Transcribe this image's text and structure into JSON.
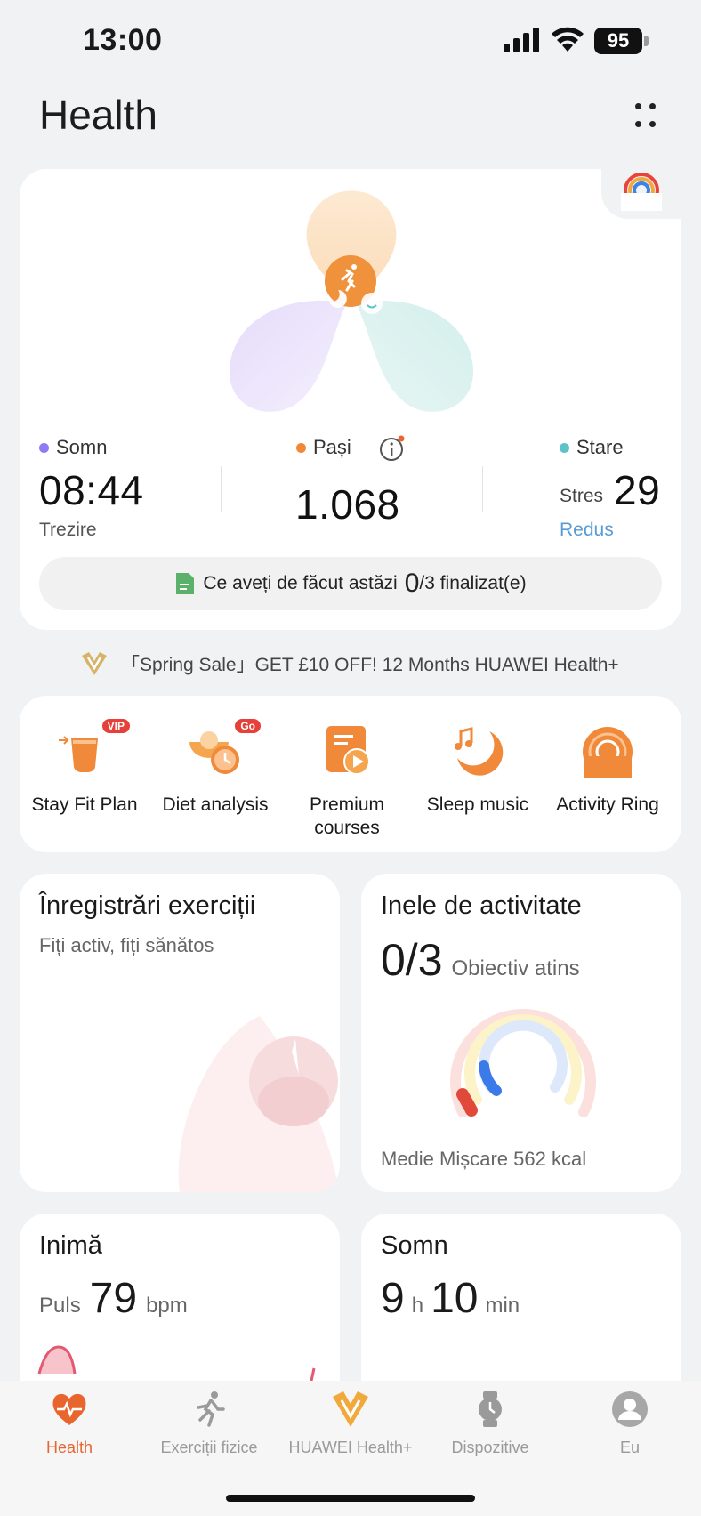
{
  "status_bar": {
    "time": "13:00",
    "battery": "95"
  },
  "header": {
    "title": "Health"
  },
  "summary": {
    "sleep": {
      "label": "Somn",
      "value": "08:44",
      "sub": "Trezire",
      "color": "#8b7cf6"
    },
    "steps": {
      "label": "Pași",
      "value": "1.068",
      "color": "#f0883a"
    },
    "mood": {
      "label": "Stare",
      "prefix": "Stres",
      "value": "29",
      "sub": "Redus",
      "color": "#5ec3c9"
    },
    "todo": {
      "text": "Ce aveți de făcut astăzi",
      "done": "0",
      "total": "/3 finalizat(e)"
    }
  },
  "promo": {
    "text": "「Spring Sale」GET £10 OFF!  12 Months HUAWEI Health+"
  },
  "quick_actions": [
    {
      "label": "Stay Fit Plan",
      "tag": "VIP",
      "icon": "fit-plan-icon"
    },
    {
      "label": "Diet analysis",
      "tag": "Go",
      "icon": "diet-icon"
    },
    {
      "label": "Premium courses",
      "tag": "",
      "icon": "courses-icon"
    },
    {
      "label": "Sleep music",
      "tag": "",
      "icon": "sleep-music-icon"
    },
    {
      "label": "Activity Ring",
      "tag": "",
      "icon": "activity-ring-icon"
    }
  ],
  "tiles": {
    "exercise": {
      "title": "Înregistrări exerciții",
      "sub": "Fiți activ, fiți sănătos"
    },
    "rings": {
      "title": "Inele de activitate",
      "value": "0/3",
      "unit": "Obiectiv atins",
      "footer": "Medie Mișcare 562 kcal"
    },
    "heart": {
      "title": "Inimă",
      "prefix": "Puls",
      "value": "79",
      "unit": "bpm"
    },
    "sleep": {
      "title": "Somn",
      "hours": "9",
      "h": "h",
      "mins": "10",
      "min": "min"
    }
  },
  "nav": [
    {
      "label": "Health",
      "active": true
    },
    {
      "label": "Exerciții fizice",
      "active": false
    },
    {
      "label": "HUAWEI Health+",
      "active": false
    },
    {
      "label": "Dispozitive",
      "active": false
    },
    {
      "label": "Eu",
      "active": false
    }
  ],
  "colors": {
    "accent": "#e8662d",
    "link": "#5b9bd5"
  }
}
